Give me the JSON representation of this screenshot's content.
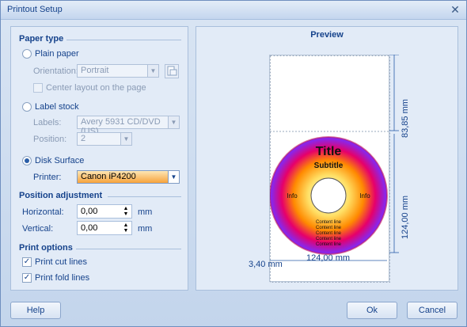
{
  "window": {
    "title": "Printout Setup",
    "close_icon": "close-icon"
  },
  "paper_type": {
    "heading": "Paper type",
    "plain_paper": {
      "label": "Plain paper",
      "selected": false
    },
    "orientation": {
      "label": "Orientation:",
      "value": "Portrait"
    },
    "center_layout": {
      "label": "Center layout on the page",
      "checked": false
    },
    "label_stock": {
      "label": "Label stock",
      "selected": false
    },
    "labels": {
      "label": "Labels:",
      "value": "Avery 5931 CD/DVD (US)"
    },
    "position": {
      "label": "Position:",
      "value": "2"
    },
    "disk_surface": {
      "label": "Disk Surface",
      "selected": true
    },
    "printer": {
      "label": "Printer:",
      "value": "Canon iP4200"
    }
  },
  "position_adjustment": {
    "heading": "Position adjustment",
    "horizontal": {
      "label": "Horizontal:",
      "value": "0,00",
      "unit": "mm"
    },
    "vertical": {
      "label": "Vertical:",
      "value": "0,00",
      "unit": "mm"
    }
  },
  "print_options": {
    "heading": "Print options",
    "cut_lines": {
      "label": "Print cut lines",
      "checked": true
    },
    "fold_lines": {
      "label": "Print fold lines",
      "checked": true
    }
  },
  "preview": {
    "heading": "Preview",
    "disc": {
      "title": "Title",
      "subtitle": "Subtitle",
      "info_left": "Info",
      "info_right": "Info",
      "content_lines": [
        "Content line",
        "Content line",
        "Content line",
        "Content line",
        "Content line"
      ]
    },
    "dims": {
      "top_margin": "83,85 mm",
      "disc_height": "124,00 mm",
      "disc_width": "124,00 mm",
      "left_margin": "3,40 mm"
    }
  },
  "buttons": {
    "help": "Help",
    "ok": "Ok",
    "cancel": "Cancel"
  },
  "colors": {
    "accent": "#15428b",
    "panel": "#e2ebf7",
    "active_combo": "#f7a33b"
  }
}
